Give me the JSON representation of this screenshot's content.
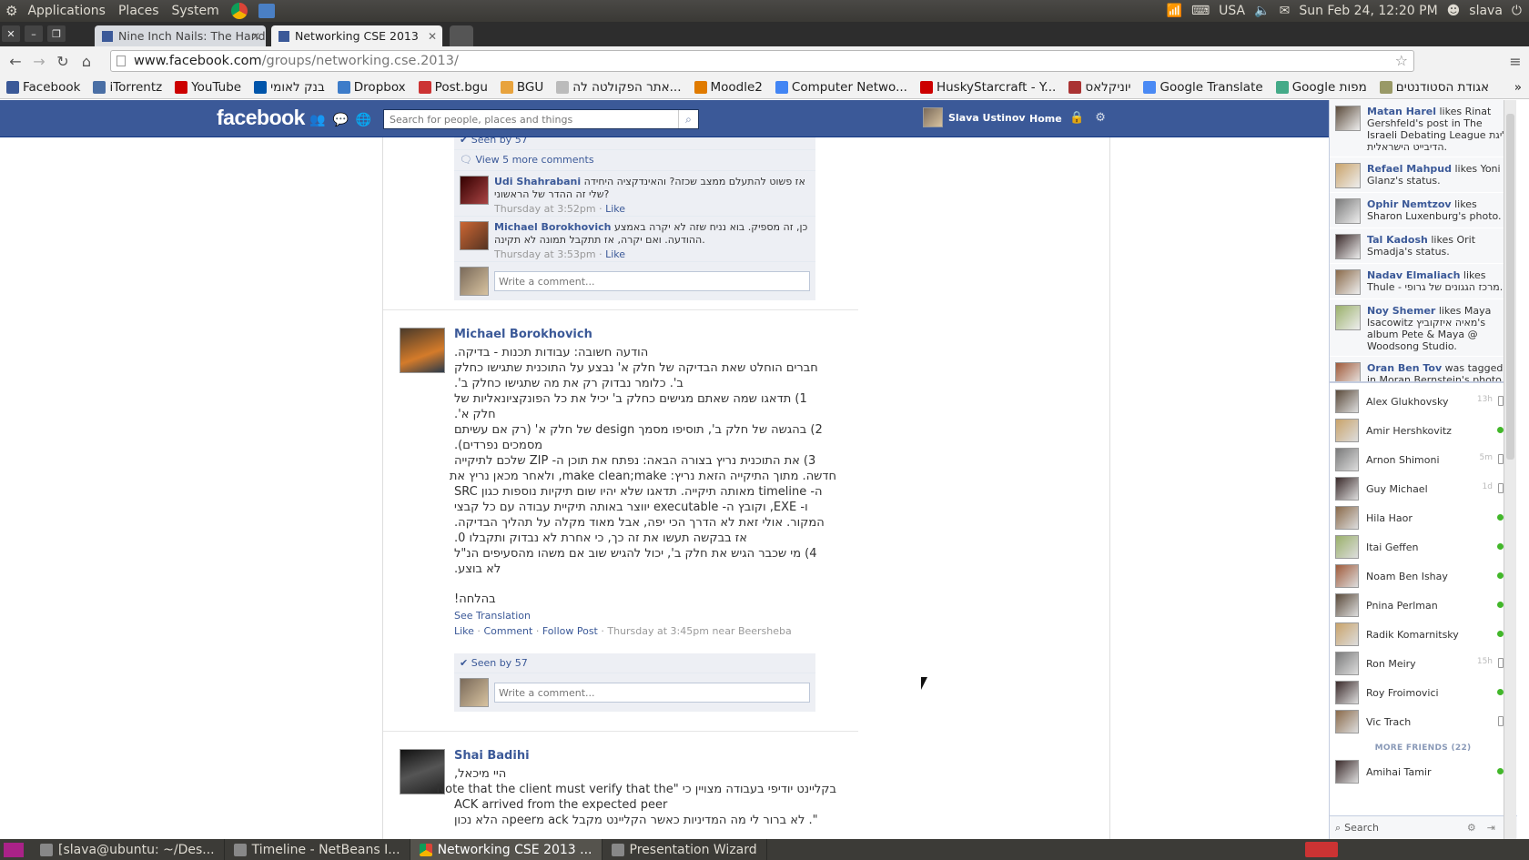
{
  "system": {
    "menus": [
      "Applications",
      "Places",
      "System"
    ],
    "keyboard": "USA",
    "datetime": "Sun Feb 24, 12:20 PM",
    "user": "slava"
  },
  "tabs": [
    {
      "label": "Nine Inch Nails: The Hand",
      "active": false
    },
    {
      "label": "Networking CSE 2013",
      "active": true
    }
  ],
  "url": {
    "domain": "www.facebook.com",
    "path": "/groups/networking.cse.2013/"
  },
  "bookmarks": [
    {
      "label": "Facebook",
      "icon": "facebook-icon",
      "color": "#3b5998"
    },
    {
      "label": "iTorrentz",
      "icon": "torrent-icon",
      "color": "#4a6fa5"
    },
    {
      "label": "YouTube",
      "icon": "youtube-icon",
      "color": "#cc0000"
    },
    {
      "label": "בנק לאומי",
      "icon": "bank-icon",
      "color": "#0055aa"
    },
    {
      "label": "Dropbox",
      "icon": "dropbox-icon",
      "color": "#3d7cc9"
    },
    {
      "label": "Post.bgu",
      "icon": "mail-icon",
      "color": "#c33"
    },
    {
      "label": "BGU",
      "icon": "bgu-icon",
      "color": "#e8a33d"
    },
    {
      "label": "אתר הפקולטה לה...",
      "icon": "page-icon",
      "color": "#bbb"
    },
    {
      "label": "Moodle2",
      "icon": "moodle-icon",
      "color": "#e07b00"
    },
    {
      "label": "Computer Netwo...",
      "icon": "google-icon",
      "color": "#4285f4"
    },
    {
      "label": "HuskyStarcraft - Y...",
      "icon": "youtube-icon",
      "color": "#cc0000"
    },
    {
      "label": "יוניקלאס",
      "icon": "shield-icon",
      "color": "#a33"
    },
    {
      "label": "Google Translate",
      "icon": "translate-icon",
      "color": "#4a8af4"
    },
    {
      "label": "Google מפות",
      "icon": "maps-icon",
      "color": "#4a8"
    },
    {
      "label": "אגודת הסטודנטים",
      "icon": "student-icon",
      "color": "#996"
    }
  ],
  "facebook": {
    "logo": "facebook",
    "search_placeholder": "Search for people, places and things",
    "user_name": "Slava Ustinov",
    "home": "Home"
  },
  "top_post": {
    "seen": "Seen by 57",
    "view_more": "View 5 more comments",
    "comments": [
      {
        "name": "Udi Shahrabani",
        "text": "אז פשוט להתעלם ממצב שכזה? והאינדקציה היחידה שלי זה ההדר של הראשוני?",
        "time": "Thursday at 3:52pm",
        "like": "Like"
      },
      {
        "name": "Michael Borokhovich",
        "text": "כן, זה מספיק. בוא נניח שזה לא יקרה באמצע ההודעה. ואם יקרה, אז תתקבל תמונה לא תקינה.",
        "time": "Thursday at 3:53pm",
        "like": "Like"
      }
    ],
    "write_placeholder": "Write a comment..."
  },
  "post2": {
    "name": "Michael Borokhovich",
    "lines": [
      "הודעה חשובה: עבודות תכנות - בדיקה.",
      "חברים הוחלט שאת הבדיקה של חלק א' נבצע על התוכנית שתגישו כחלק",
      "ב'. כלומר נבדוק רק את מה שתגישו כחלק ב'.",
      "1) תדאגו שמה שאתם מגישים כחלק ב' יכיל את כל הפונקציונאליות של",
      "חלק א'.",
      "2) בהגשה של חלק ב', תוסיפו מסמך design של חלק א' (רק אם עשיתם",
      "מסמכים נפרדים).",
      "3) את התוכנית נריץ בצורה הבאה: נפתח את תוכן ה- ZIP שלכם לתיקייה",
      "חדשה. מתוך התיקייה הזאת נריץ: make clean;make, ולאחר מכאן נריץ את",
      "ה- timeline מאותה תיקייה. תדאגו שלא יהיו שום תיקיות נוספות כגון SRC",
      "ו- EXE, וקובץ ה- executable יווצר באותה תיקיית עבודה עם כל קבצי",
      "המקור. אולי זאת לא הדרך הכי יפה, אבל מאוד מקלה על תהליך הבדיקה.",
      "אז בבקשה תעשו את זה כך, כי אחרת לא נבדוק ותקבלו 0.",
      "4) מי שכבר הגיש את חלק ב', יכול להגיש שוב אם משהו מהסעיפים הנ\"ל",
      "לא בוצע.",
      "",
      "בהלחה!"
    ],
    "see_translation": "See Translation",
    "actions": [
      "Like",
      "Comment",
      "Follow Post"
    ],
    "time": "Thursday at 3:45pm near Beersheba",
    "seen": "Seen by 57",
    "write_placeholder": "Write a comment..."
  },
  "post3": {
    "name": "Shai Badihi",
    "lines": [
      "היי מיכאל,",
      "בקליינט יודיפי בעבודה מצויין כי \"Note that the client must verify that the",
      "ACK arrived from the expected peer",
      "\". לא ברור לי מה המדיניות כאשר הקליינט מקבל ack מpeerה הלא נכון"
    ]
  },
  "ticker": [
    {
      "name": "Matan Harel",
      "text": " likes Rinat Gershfeld's post in The Israeli Debating League ליגת הדיבייט הישראלית."
    },
    {
      "name": "Refael Mahpud",
      "text": " likes Yoni Glanz's status."
    },
    {
      "name": "Ophir Nemtzov",
      "text": " likes Sharon Luxenburg's photo."
    },
    {
      "name": "Tal Kadosh",
      "text": " likes Orit Smadja's status."
    },
    {
      "name": "Nadav Elmaliach",
      "text": " likes Thule - מרכז הגגונים של גרופי."
    },
    {
      "name": "Noy Shemer",
      "text": " likes Maya Isacowitz מאיה איזקוביץ's album Pete & Maya @ Woodsong Studio."
    },
    {
      "name": "Oran Ben Tov",
      "text": " was tagged in Moran Bernstein's photo. — with"
    }
  ],
  "chat": [
    {
      "name": "Alex Glukhovsky",
      "status": "mobile",
      "time": "13h"
    },
    {
      "name": "Amir Hershkovitz",
      "status": "online",
      "time": ""
    },
    {
      "name": "Arnon Shimoni",
      "status": "mobile",
      "time": "5m"
    },
    {
      "name": "Guy Michael",
      "status": "mobile",
      "time": "1d"
    },
    {
      "name": "Hila Haor",
      "status": "online",
      "time": ""
    },
    {
      "name": "Itai Geffen",
      "status": "online",
      "time": ""
    },
    {
      "name": "Noam Ben Ishay",
      "status": "online",
      "time": ""
    },
    {
      "name": "Pnina Perlman",
      "status": "online",
      "time": ""
    },
    {
      "name": "Radik Komarnitsky",
      "status": "online",
      "time": ""
    },
    {
      "name": "Ron Meiry",
      "status": "mobile",
      "time": "15h"
    },
    {
      "name": "Roy Froimovici",
      "status": "online",
      "time": ""
    },
    {
      "name": "Vic Trach",
      "status": "mobile",
      "time": ""
    }
  ],
  "more_friends": "MORE FRIENDS (22)",
  "more_chat": [
    {
      "name": "Amihai Tamir",
      "status": "online"
    }
  ],
  "chat_search": "Search",
  "taskbar": [
    {
      "label": "[slava@ubuntu: ~/Des...",
      "icon": "terminal-icon"
    },
    {
      "label": "Timeline - NetBeans I...",
      "icon": "netbeans-icon"
    },
    {
      "label": "Networking CSE 2013 ...",
      "icon": "chrome-icon",
      "active": true
    },
    {
      "label": "Presentation Wizard",
      "icon": "presentation-icon"
    }
  ]
}
